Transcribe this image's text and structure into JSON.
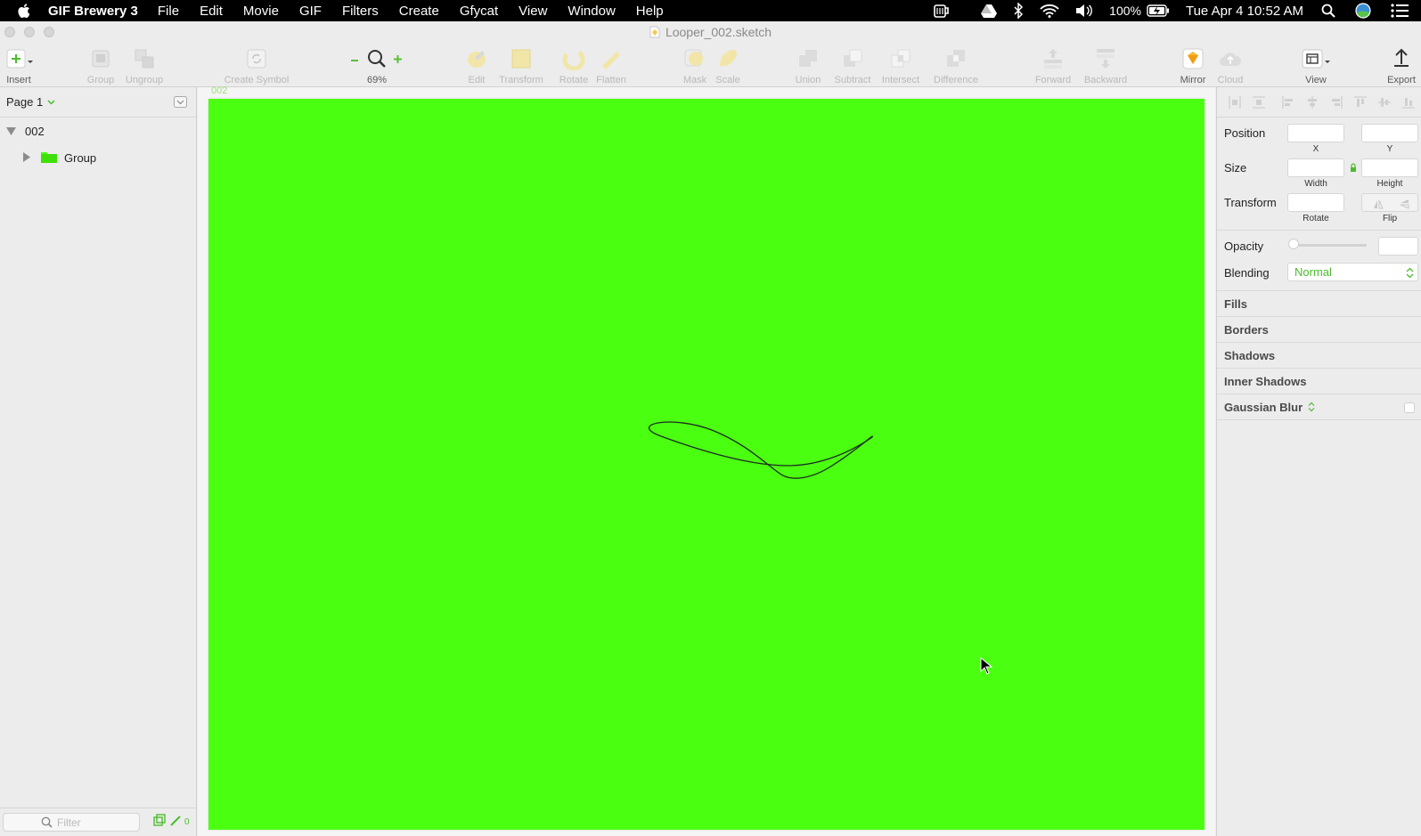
{
  "menubar": {
    "app_name": "GIF Brewery 3",
    "menus": [
      "File",
      "Edit",
      "Movie",
      "GIF",
      "Filters",
      "Create",
      "Gfycat",
      "View",
      "Window",
      "Help"
    ],
    "battery": "100%",
    "clock": "Tue Apr 4  10:52 AM"
  },
  "window": {
    "title": "Looper_002.sketch"
  },
  "toolbar": {
    "insert": "Insert",
    "group": "Group",
    "ungroup": "Ungroup",
    "create_symbol": "Create Symbol",
    "zoom": "69%",
    "edit": "Edit",
    "transform": "Transform",
    "rotate": "Rotate",
    "flatten": "Flatten",
    "mask": "Mask",
    "scale": "Scale",
    "union": "Union",
    "subtract": "Subtract",
    "intersect": "Intersect",
    "difference": "Difference",
    "forward": "Forward",
    "backward": "Backward",
    "mirror": "Mirror",
    "cloud": "Cloud",
    "view": "View",
    "export": "Export"
  },
  "layers": {
    "page": "Page 1",
    "artboard": "002",
    "group": "Group",
    "filter_placeholder": "Filter",
    "filter_count": "0"
  },
  "canvas": {
    "artboard_label": "002",
    "artboard_color": "#4bff10"
  },
  "inspector": {
    "position": "Position",
    "x": "X",
    "y": "Y",
    "size": "Size",
    "width": "Width",
    "height": "Height",
    "transform": "Transform",
    "rotate": "Rotate",
    "flip": "Flip",
    "opacity": "Opacity",
    "blending": "Blending",
    "blending_value": "Normal",
    "fills": "Fills",
    "borders": "Borders",
    "shadows": "Shadows",
    "inner_shadows": "Inner Shadows",
    "gaussian_blur": "Gaussian Blur"
  },
  "colors": {
    "accent": "#4bff10",
    "panel": "#ececec"
  }
}
